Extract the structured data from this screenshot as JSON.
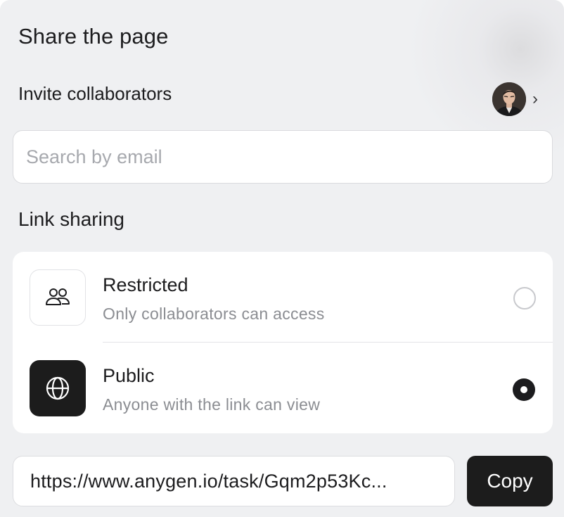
{
  "dialog": {
    "title": "Share the page"
  },
  "invite": {
    "label": "Invite collaborators",
    "avatar_icon": "user-avatar-photo",
    "chevron_glyph": "›"
  },
  "search": {
    "placeholder": "Search by email",
    "value": ""
  },
  "link_sharing": {
    "label": "Link sharing",
    "options": [
      {
        "title": "Restricted",
        "subtitle": "Only collaborators can access",
        "icon": "people-icon",
        "selected": false
      },
      {
        "title": "Public",
        "subtitle": "Anyone with the link can view",
        "icon": "globe-icon",
        "selected": true
      }
    ]
  },
  "share_link": {
    "url": "https://www.anygen.io/task/Gqm2p53Kc...",
    "copy_label": "Copy"
  },
  "colors": {
    "background": "#eff0f2",
    "surface": "#ffffff",
    "accent_dark": "#1c1c1c",
    "muted_text": "#8b8d92",
    "placeholder_text": "#a7a9ae"
  }
}
